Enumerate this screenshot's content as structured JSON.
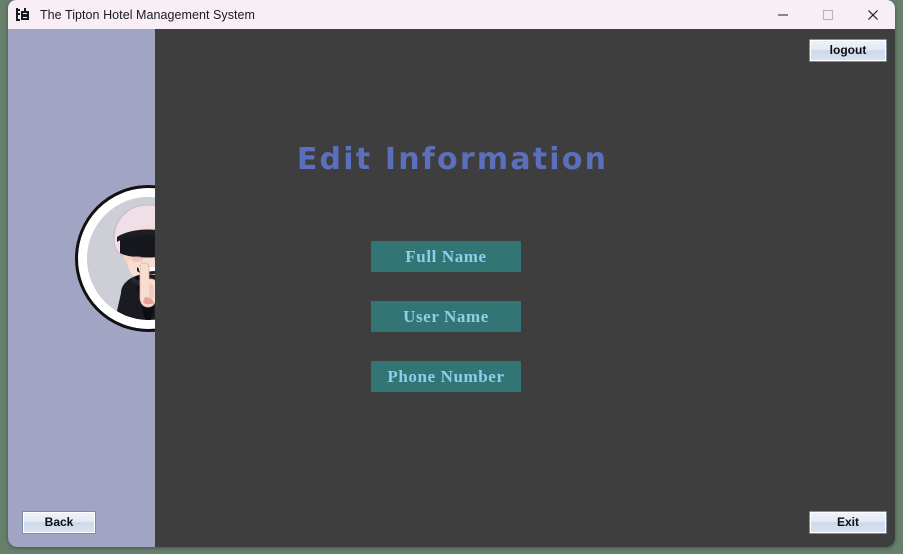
{
  "window": {
    "title": "The Tipton Hotel Management System",
    "icon": "app-icon",
    "controls": {
      "minimize": "minimize-icon",
      "maximize": "maximize-icon",
      "close": "close-icon"
    }
  },
  "colors": {
    "desktop": "#67806c",
    "titlebar": "#f8eef5",
    "sidebar": "#a2a4c4",
    "content": "#3e3e3e",
    "heading_text": "#5b6fbd",
    "action_button_bg": "#337575",
    "action_button_text": "#8bd0e8"
  },
  "header": {
    "logout_label": "logout"
  },
  "sidebar": {
    "avatar_alt": "user-avatar"
  },
  "main": {
    "heading": "Edit Information",
    "actions": [
      {
        "label": "Full Name"
      },
      {
        "label": "User Name"
      },
      {
        "label": "Phone Number"
      }
    ]
  },
  "footer": {
    "back_label": "Back",
    "exit_label": "Exit"
  }
}
